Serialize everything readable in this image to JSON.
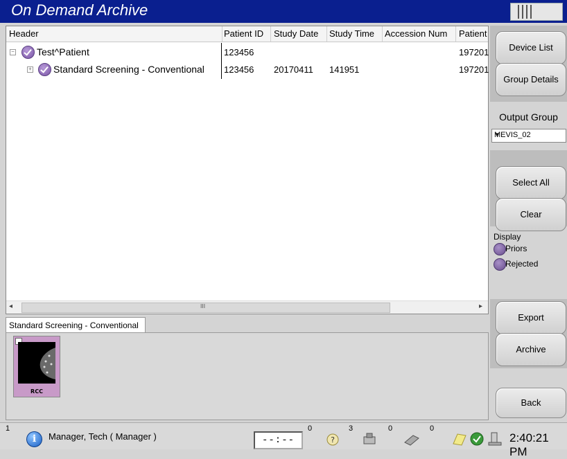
{
  "window": {
    "title": "On Demand Archive"
  },
  "grid": {
    "columns": [
      "Header",
      "Patient ID",
      "Study Date",
      "Study Time",
      "Accession Num",
      "Patient"
    ],
    "rows": [
      {
        "header": "Test^Patient",
        "patient_id": "123456",
        "study_date": "",
        "study_time": "",
        "accession": "",
        "patient": "197201"
      },
      {
        "header": "Standard Screening - Conventional",
        "patient_id": "123456",
        "study_date": "20170411",
        "study_time": "141951",
        "accession": "",
        "patient": "197201"
      }
    ],
    "scroll_grip": "III"
  },
  "tab": {
    "label": "Standard Screening - Conventional"
  },
  "thumbnail": {
    "label": "RCC"
  },
  "side": {
    "device_list": "Device List",
    "group_details": "Group Details",
    "output_group_label": "Output Group",
    "output_group_value": "MEVIS_02",
    "select_all": "Select All",
    "clear": "Clear",
    "display_label": "Display",
    "priors": "Priors",
    "rejected": "Rejected",
    "export": "Export",
    "archive": "Archive",
    "back": "Back"
  },
  "status": {
    "alert_count": "1",
    "user": "Manager, Tech ( Manager )",
    "timer": "--:--",
    "count_timer": "0",
    "count_help": "3",
    "count_device": "0",
    "count_printer": "0",
    "time": "2:40:21 PM"
  },
  "colors": {
    "title_bar": "#0a1f8f",
    "accent_purple": "#7a55a6"
  }
}
